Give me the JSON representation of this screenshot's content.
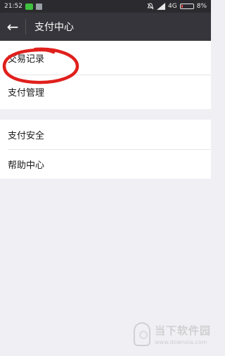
{
  "status_bar": {
    "time": "21:52",
    "network": "4G",
    "battery_text": "8%",
    "battery_level": 0.08,
    "icons": [
      "wechat-icon",
      "sim-icon",
      "mute-icon",
      "signal-icon",
      "battery-icon"
    ]
  },
  "header": {
    "back_icon": "←",
    "title": "支付中心"
  },
  "group1": {
    "items": [
      {
        "label": "交易记录"
      },
      {
        "label": "支付管理"
      }
    ]
  },
  "group2": {
    "items": [
      {
        "label": "支付安全"
      },
      {
        "label": "帮助中心"
      }
    ]
  },
  "watermark": {
    "name": "当下软件园",
    "url": "www.downxia.com"
  },
  "colors": {
    "header_bg": "#35353b",
    "page_bg": "#efeff4",
    "annotation": "#e0201c"
  }
}
